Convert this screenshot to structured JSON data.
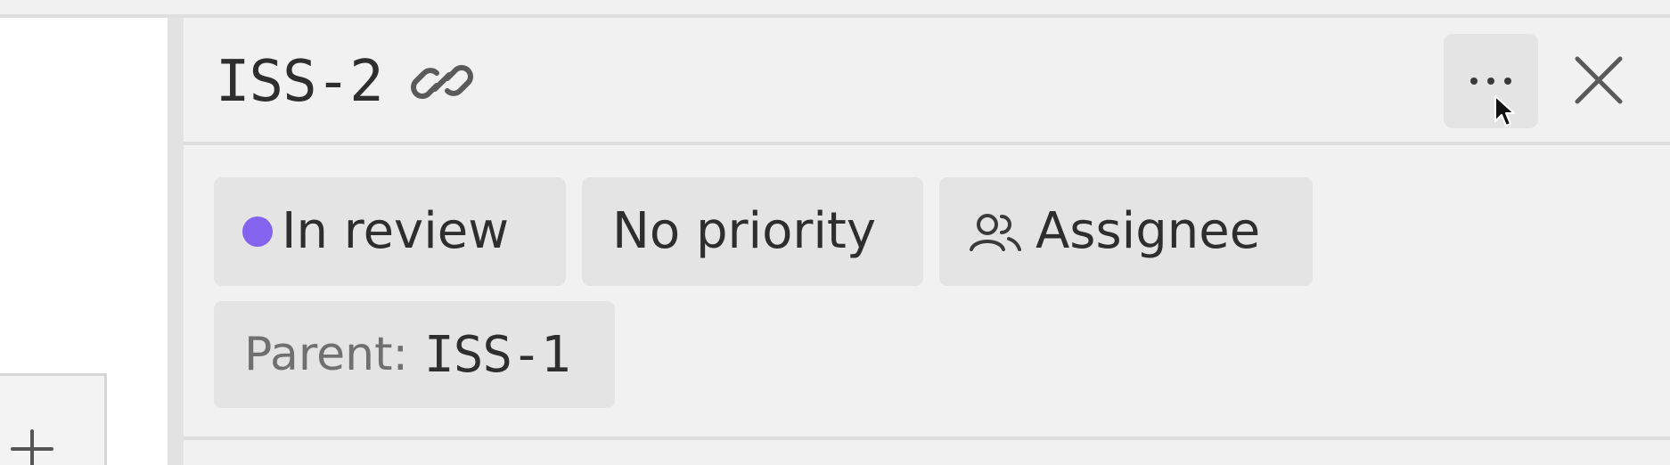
{
  "issue": {
    "id": "ISS-2"
  },
  "properties": {
    "status": {
      "label": "In review",
      "color": "#8463ef"
    },
    "priority": {
      "label": "No priority"
    },
    "assignee": {
      "label": "Assignee",
      "icon": "users-icon"
    },
    "parent": {
      "label": "Parent:",
      "value": "ISS-1"
    }
  },
  "header": {
    "link_icon": "link-icon",
    "more_icon": "more-horizontal-icon",
    "close_icon": "close-icon"
  },
  "sidebar": {
    "add_icon": "plus-icon"
  }
}
